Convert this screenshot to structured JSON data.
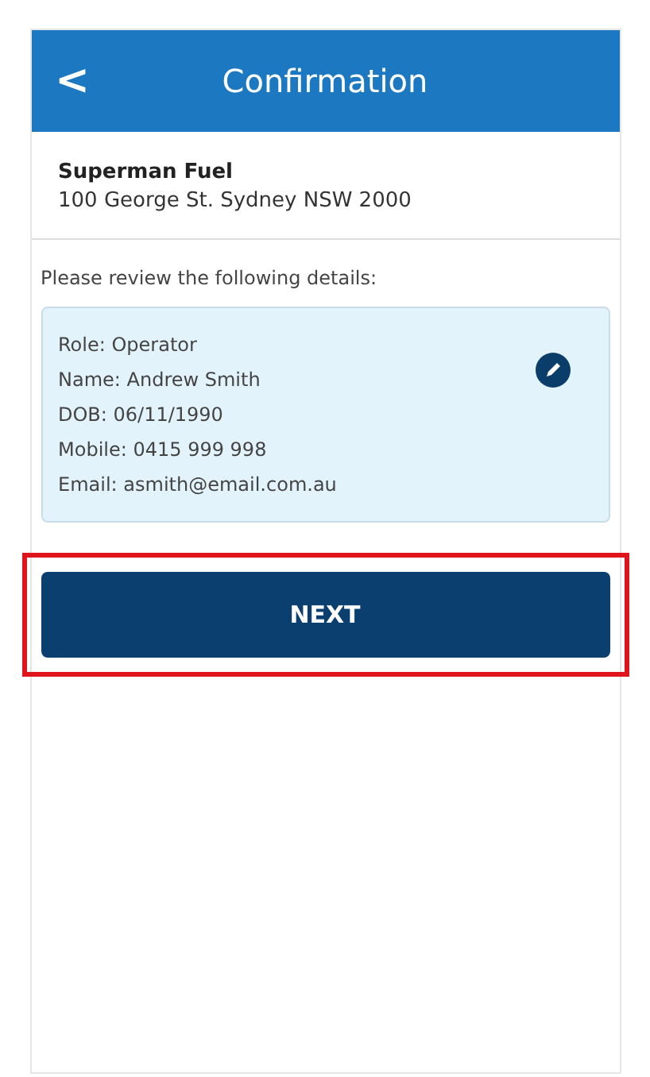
{
  "header": {
    "back_icon_char": "<",
    "title": "Confirmation"
  },
  "site": {
    "name": "Superman Fuel",
    "address": "100 George St. Sydney NSW 2000"
  },
  "prompt": "Please review the following details:",
  "details": [
    "Role: Operator",
    "Name: Andrew Smith",
    "DOB: 06/11/1990",
    "Mobile: 0415 999 998",
    "Email: asmith@email.com.au"
  ],
  "next_button": {
    "label": "NEXT",
    "highlighted": true
  }
}
